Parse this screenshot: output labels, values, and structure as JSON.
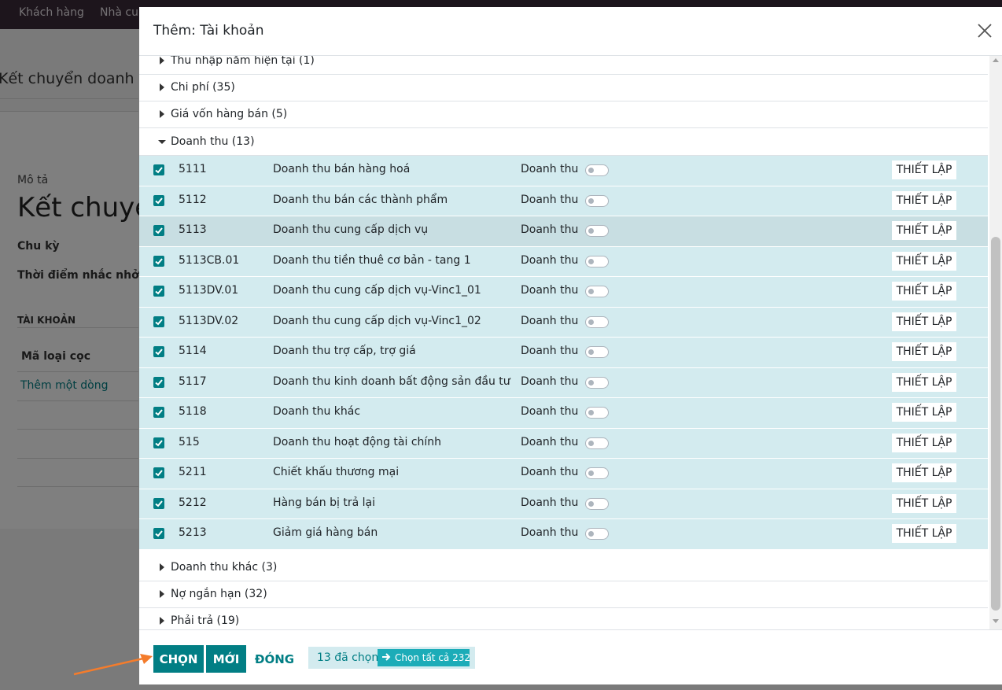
{
  "background": {
    "topbar": [
      "Khách hàng",
      "Nhà cung cấp"
    ],
    "breadcrumb": "Kết chuyển doanh thu",
    "fields": {
      "description_label": "Mô tả",
      "record_title": "Kết chuyển",
      "cycle_label": "Chu kỳ",
      "reminder_label": "Thời điểm nhắc nhở",
      "accounts_section": "TÀI KHOẢN",
      "column_deposit_type": "Mã loại cọc",
      "add_line": "Thêm một dòng"
    }
  },
  "dialog": {
    "title": "Thêm: Tài khoản",
    "groups_before": [
      {
        "label": "Thu nhập năm hiện tại (1)"
      },
      {
        "label": "Chi phí (35)"
      },
      {
        "label": "Giá vốn hàng bán (5)"
      }
    ],
    "open_group": {
      "label": "Doanh thu (13)"
    },
    "records": [
      {
        "code": "5111",
        "name": "Doanh thu bán hàng hoá",
        "type": "Doanh thu",
        "action": "THIẾT LẬP"
      },
      {
        "code": "5112",
        "name": "Doanh thu bán các thành phẩm",
        "type": "Doanh thu",
        "action": "THIẾT LẬP"
      },
      {
        "code": "5113",
        "name": "Doanh thu cung cấp dịch vụ",
        "type": "Doanh thu",
        "action": "THIẾT LẬP"
      },
      {
        "code": "5113CB.01",
        "name": "Doanh thu tiền thuê cơ bản - tang 1",
        "type": "Doanh thu",
        "action": "THIẾT LẬP"
      },
      {
        "code": "5113DV.01",
        "name": "Doanh thu cung cấp dịch vụ-Vinc1_01",
        "type": "Doanh thu",
        "action": "THIẾT LẬP"
      },
      {
        "code": "5113DV.02",
        "name": "Doanh thu cung cấp dịch vụ-Vinc1_02",
        "type": "Doanh thu",
        "action": "THIẾT LẬP"
      },
      {
        "code": "5114",
        "name": "Doanh thu trợ cấp, trợ giá",
        "type": "Doanh thu",
        "action": "THIẾT LẬP"
      },
      {
        "code": "5117",
        "name": "Doanh thu kinh doanh bất động sản đầu tư",
        "type": "Doanh thu",
        "action": "THIẾT LẬP"
      },
      {
        "code": "5118",
        "name": "Doanh thu khác",
        "type": "Doanh thu",
        "action": "THIẾT LẬP"
      },
      {
        "code": "515",
        "name": "Doanh thu hoạt động tài chính",
        "type": "Doanh thu",
        "action": "THIẾT LẬP"
      },
      {
        "code": "5211",
        "name": "Chiết khấu thương mại",
        "type": "Doanh thu",
        "action": "THIẾT LẬP"
      },
      {
        "code": "5212",
        "name": "Hàng bán bị trả lại",
        "type": "Doanh thu",
        "action": "THIẾT LẬP"
      },
      {
        "code": "5213",
        "name": "Giảm giá hàng bán",
        "type": "Doanh thu",
        "action": "THIẾT LẬP"
      }
    ],
    "groups_after": [
      {
        "label": "Doanh thu khác (3)"
      },
      {
        "label": "Nợ ngắn hạn (32)"
      },
      {
        "label": "Phải trả (19)"
      }
    ],
    "footer": {
      "select_label": "CHỌN",
      "new_label": "MỚI",
      "close_label": "ĐÓNG",
      "selected_count": "13 đã chọn",
      "select_all": "Chọn tất cả 232"
    }
  },
  "colors": {
    "primary": "#017e84",
    "selected_row": "#d3ebef",
    "select_all_badge": "#1cacb8",
    "annotation_arrow": "#f47c2c"
  },
  "icons": {
    "close": "close-icon",
    "group_collapsed": "caret-right-icon",
    "group_expanded": "caret-down-icon",
    "checkbox": "checkbox-checked-icon",
    "select_all": "arrow-right-icon"
  }
}
